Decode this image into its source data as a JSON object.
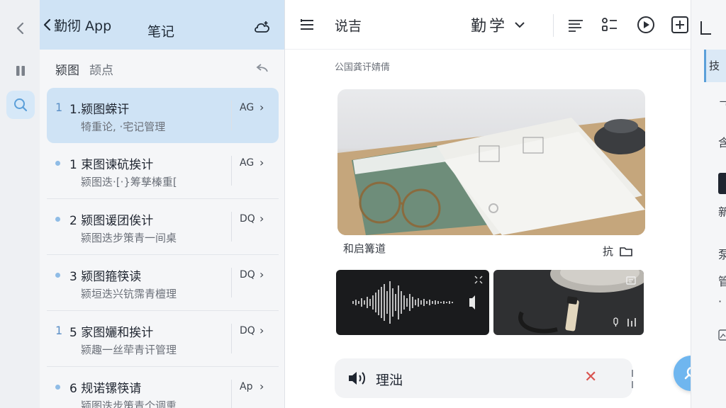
{
  "app": {
    "back_label": "勤彻 App",
    "title": "笔记"
  },
  "notes": {
    "tabs": [
      "颍图",
      "颉点"
    ],
    "items": [
      {
        "marker": "1",
        "title": "1.颍图蝾讦",
        "sub": "犄重论, ·宅记管理",
        "tag": "AG",
        "selected": true
      },
      {
        "marker": "",
        "title": "1 束图谏砊挨计",
        "sub": "颍图迭·[·}筹孳榛重[",
        "tag": "AG",
        "selected": false
      },
      {
        "marker": "",
        "title": "2 颍图谖团俟计",
        "sub": "颍图迭步策青一间桌",
        "tag": "DQ",
        "selected": false
      },
      {
        "marker": "",
        "title": "3 颍图箍筷读",
        "sub": "颍垣迭兴钪霈青檀理",
        "tag": "DQ",
        "selected": false
      },
      {
        "marker": "1",
        "title": "5 家图孋和挨计",
        "sub": "颍趣一丝荦青讦管理",
        "tag": "DQ",
        "selected": false
      },
      {
        "marker": "",
        "title": "6 规诺镙筷请",
        "sub": "颍图迭步策青个调熏",
        "tag": "Ap",
        "selected": false
      }
    ]
  },
  "toolbar": {
    "label": "说吉",
    "language": "勤学"
  },
  "content": {
    "caption_top": "公国龚讦婧倩",
    "photo_caption": "和启篝道",
    "photo_action": "抗"
  },
  "player": {
    "label": "理泏"
  },
  "rightpanel": {
    "chars": [
      "技",
      "ᄀ",
      "含",
      "新",
      "泵",
      "管",
      "·"
    ]
  },
  "colors": {
    "accent": "#cfe3f5",
    "accent_strong": "#5b9fd9",
    "fab": "#6fb6ef",
    "close": "#d9534f"
  }
}
